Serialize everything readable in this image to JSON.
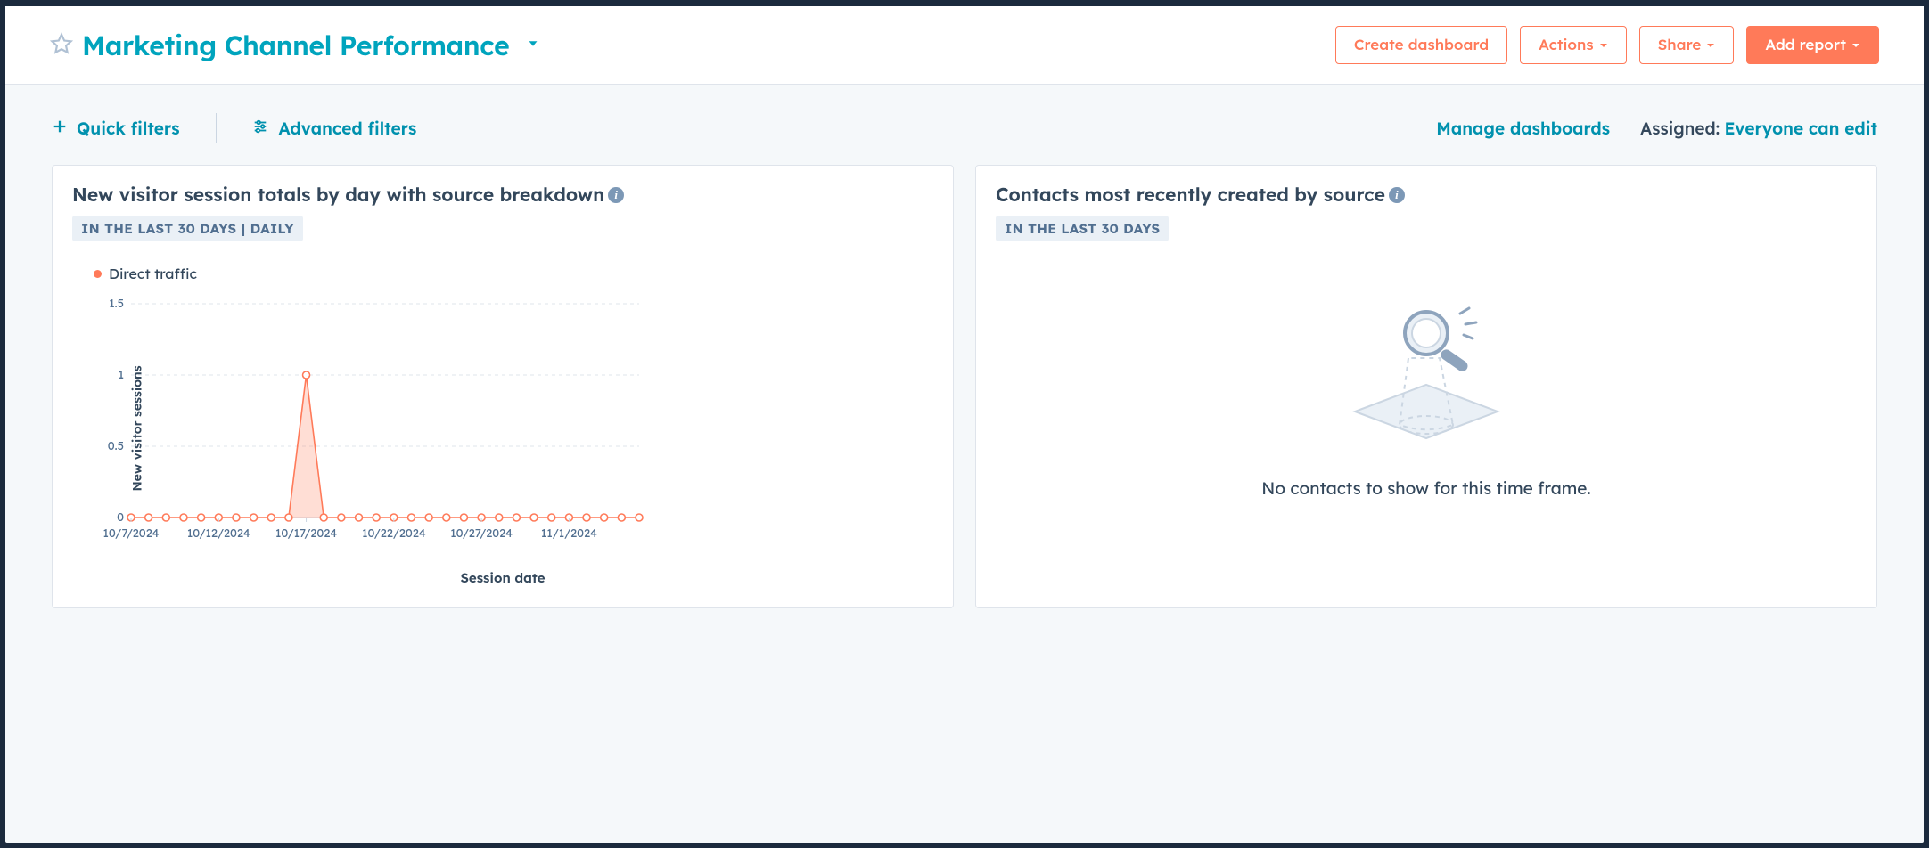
{
  "header": {
    "title": "Marketing Channel Performance",
    "create_dashboard": "Create dashboard",
    "actions": "Actions",
    "share": "Share",
    "add_report": "Add report"
  },
  "toolbar": {
    "quick_filters": "Quick filters",
    "advanced_filters": "Advanced filters",
    "manage_dashboards": "Manage dashboards",
    "assigned_label": "Assigned:",
    "assigned_value": "Everyone can edit"
  },
  "cards": {
    "visitors": {
      "title": "New visitor session totals by day with source breakdown",
      "badge": "IN THE LAST 30 DAYS | DAILY",
      "legend": "Direct traffic",
      "ylabel": "New visitor sessions",
      "xlabel": "Session date"
    },
    "contacts": {
      "title": "Contacts most recently created by source",
      "badge": "IN THE LAST 30 DAYS",
      "empty": "No contacts to show for this time frame."
    }
  },
  "chart_data": {
    "type": "area",
    "title": "New visitor session totals by day with source breakdown",
    "xlabel": "Session date",
    "ylabel": "New visitor sessions",
    "ylim": [
      0,
      1.5
    ],
    "y_ticks": [
      0,
      0.5,
      1,
      1.5
    ],
    "categories": [
      "10/7/2024",
      "10/8/2024",
      "10/9/2024",
      "10/10/2024",
      "10/11/2024",
      "10/12/2024",
      "10/13/2024",
      "10/14/2024",
      "10/15/2024",
      "10/16/2024",
      "10/17/2024",
      "10/18/2024",
      "10/19/2024",
      "10/20/2024",
      "10/21/2024",
      "10/22/2024",
      "10/23/2024",
      "10/24/2024",
      "10/25/2024",
      "10/26/2024",
      "10/27/2024",
      "10/28/2024",
      "10/29/2024",
      "10/30/2024",
      "10/31/2024",
      "11/1/2024",
      "11/2/2024",
      "11/3/2024",
      "11/4/2024",
      "11/5/2024"
    ],
    "x_tick_labels": [
      "10/7/2024",
      "10/12/2024",
      "10/17/2024",
      "10/22/2024",
      "10/27/2024",
      "11/1/2024"
    ],
    "x_tick_indices": [
      0,
      5,
      10,
      15,
      20,
      25
    ],
    "series": [
      {
        "name": "Direct traffic",
        "color": "#ff7a59",
        "values": [
          0,
          0,
          0,
          0,
          0,
          0,
          0,
          0,
          0,
          0,
          1,
          0,
          0,
          0,
          0,
          0,
          0,
          0,
          0,
          0,
          0,
          0,
          0,
          0,
          0,
          0,
          0,
          0,
          0,
          0
        ]
      }
    ]
  }
}
